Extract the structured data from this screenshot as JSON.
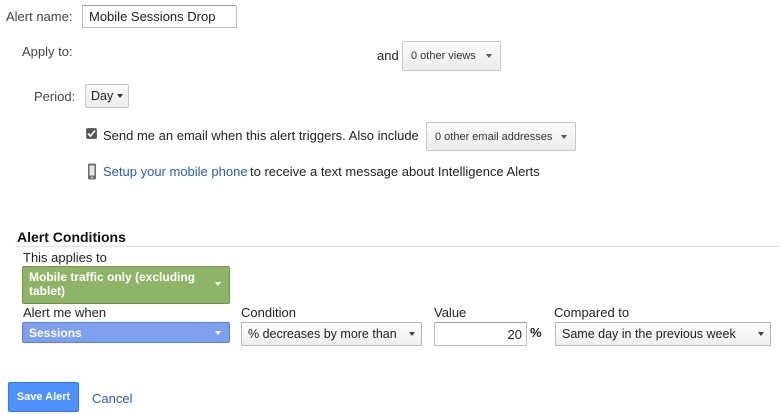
{
  "form": {
    "alert_name_label": "Alert name:",
    "alert_name_value": "Mobile Sessions Drop",
    "apply_to_label": "Apply to:",
    "and_label": "and",
    "views_select": "0 other views",
    "period_label": "Period:",
    "period_value": "Day",
    "email_checked": true,
    "email_text": "Send me an email when this alert triggers. Also include",
    "email_select": "0 other email addresses",
    "mobile_link": "Setup your mobile phone",
    "mobile_text": "to receive a text message about Intelligence Alerts"
  },
  "conditions": {
    "title": "Alert Conditions",
    "applies_to_label": "This applies to",
    "applies_to_value": "Mobile traffic only (excluding tablet)",
    "alert_me_when_label": "Alert me when",
    "alert_me_when_value": "Sessions",
    "condition_label": "Condition",
    "condition_value": "% decreases by more than",
    "value_label": "Value",
    "value_value": "20",
    "percent_symbol": "%",
    "compared_to_label": "Compared to",
    "compared_to_value": "Same day in the previous week"
  },
  "actions": {
    "save_label": "Save Alert",
    "cancel_label": "Cancel"
  },
  "colors": {
    "segment_green": "#8fb367",
    "metric_blue": "#7f9fef",
    "save_button": "#4d90fe",
    "link": "#2a5db0"
  },
  "icons": {
    "mobile_phone": "mobile-phone-icon",
    "checkbox": "checkmark-icon",
    "dropdown": "chevron-down-icon"
  }
}
